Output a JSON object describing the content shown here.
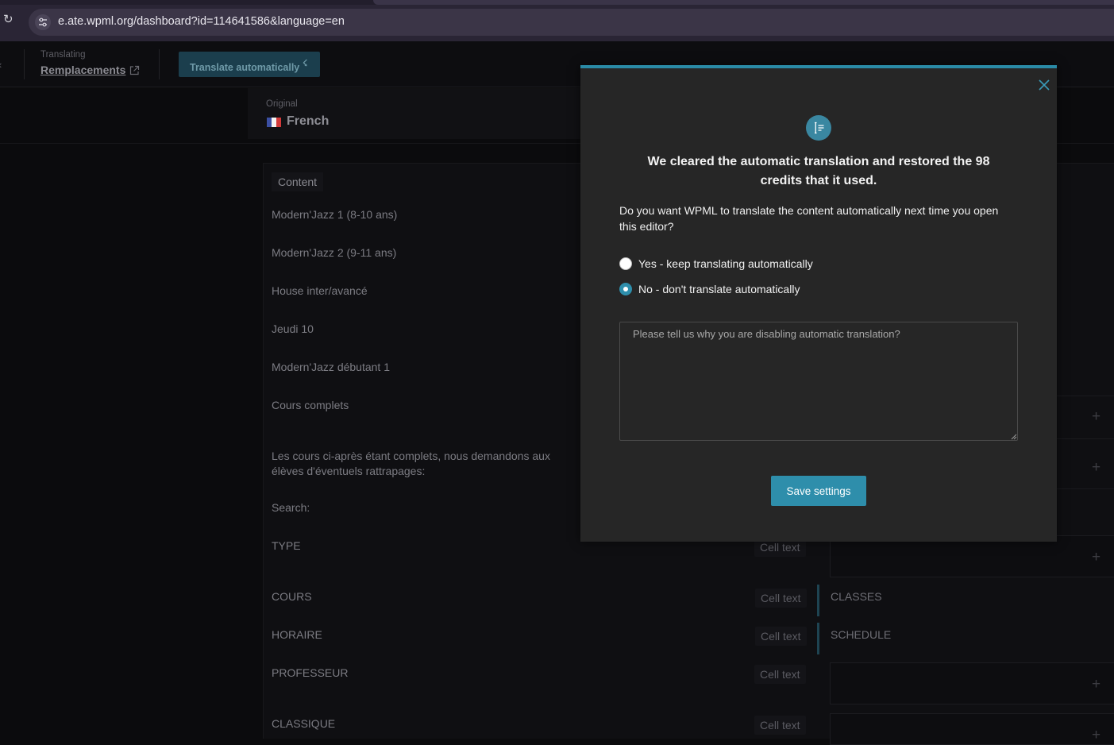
{
  "browser": {
    "url": "e.ate.wpml.org/dashboard?id=114641586&language=en"
  },
  "header": {
    "translating_label": "Translating",
    "job_title": "Remplacements",
    "translate_button": "Translate automatically"
  },
  "language": {
    "label": "Original",
    "name": "French",
    "flag_colors": [
      "#3b4fa3",
      "#f4f4f4",
      "#d23a3a"
    ]
  },
  "content": {
    "tag": "Content",
    "rows": [
      "Modern'Jazz 1 (8-10 ans)",
      "Modern'Jazz 2 (9-11 ans)",
      "House inter/avancé",
      "Jeudi 10",
      "Modern'Jazz débutant 1",
      "Cours complets",
      "Les cours ci-après étant complets, nous demandons aux élèves d'éventuels rattrapages:",
      "Search:",
      "TYPE",
      "COURS",
      "HORAIRE",
      "PROFESSEUR",
      "CLASSIQUE"
    ],
    "cell_text": "Cell text",
    "translations": {
      "cours": "CLASSES",
      "horaire": "SCHEDULE"
    }
  },
  "modal": {
    "heading": "We cleared the automatic translation and restored the 98 credits that it used.",
    "question": "Do you want WPML to translate the content automatically next time you open this editor?",
    "option_yes": "Yes - keep translating automatically",
    "option_no": "No - don't translate automatically",
    "selected": "no",
    "textarea_placeholder": "Please tell us why you are disabling automatic translation?",
    "save_button": "Save settings",
    "accent_color": "#2e8eab"
  }
}
